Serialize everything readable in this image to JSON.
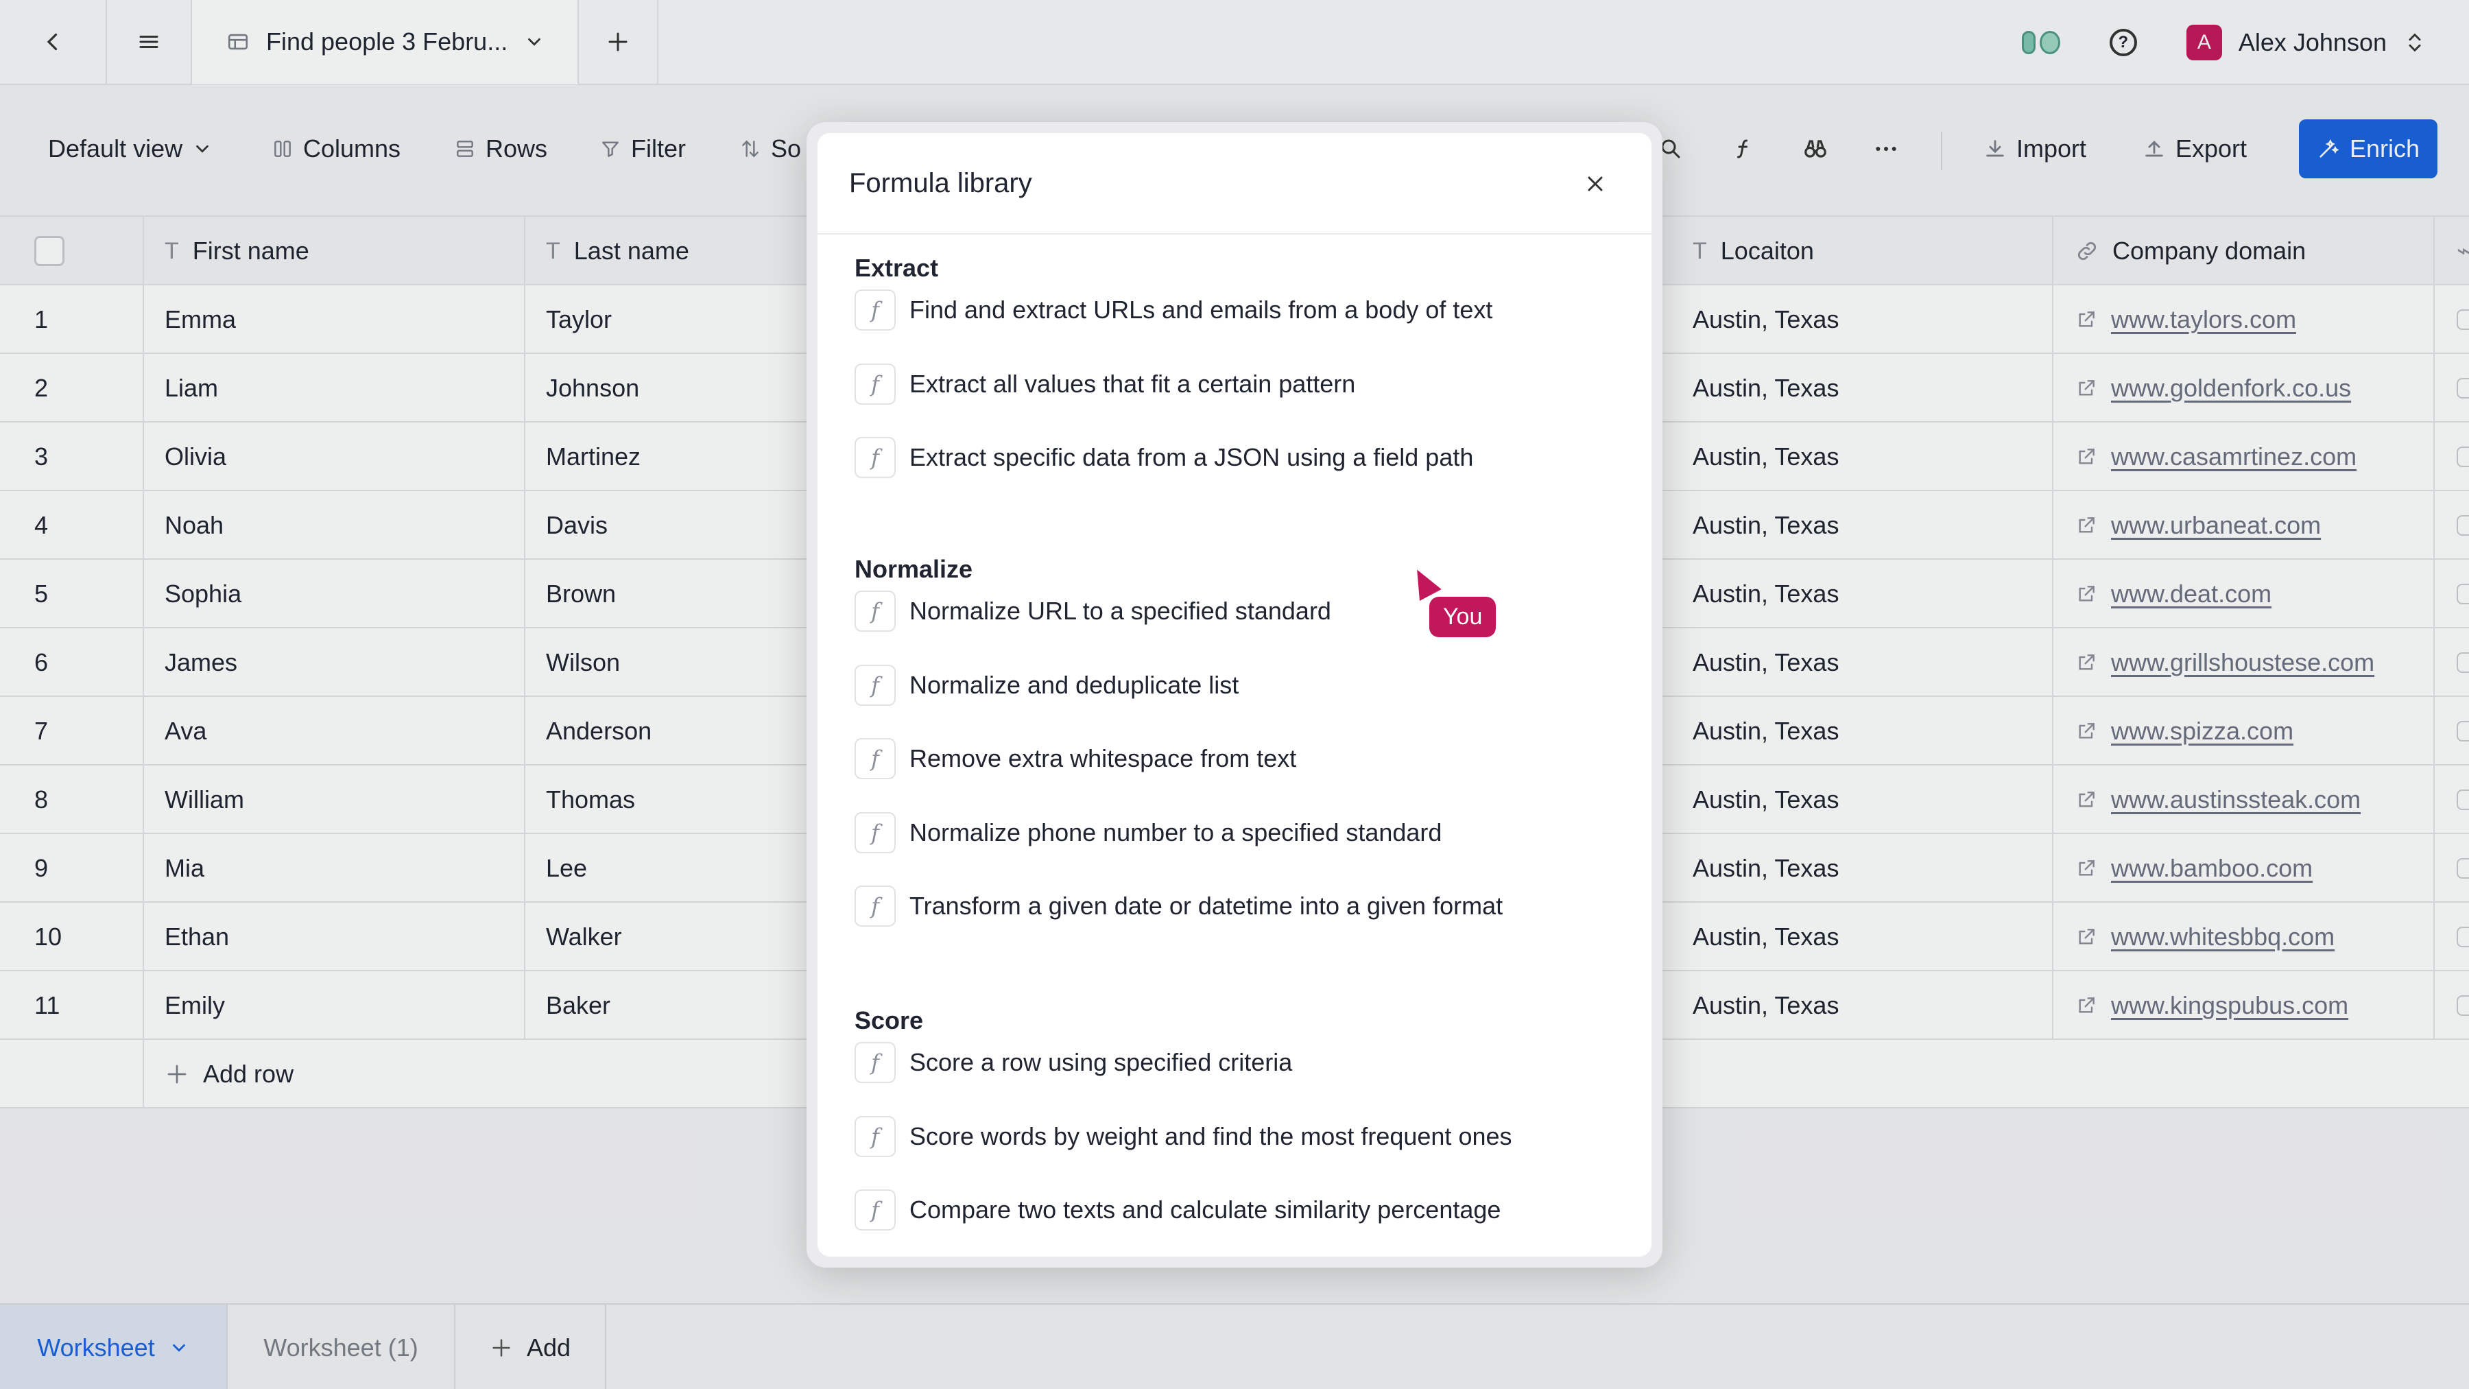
{
  "topbar": {
    "tab_title": "Find people 3 Febru...",
    "user_name": "Alex Johnson",
    "user_initial": "A"
  },
  "toolbar": {
    "view_label": "Default view",
    "columns_label": "Columns",
    "rows_label": "Rows",
    "filter_label": "Filter",
    "sort_label": "So",
    "import_label": "Import",
    "export_label": "Export",
    "enrich_label": "Enrich"
  },
  "table": {
    "headers": {
      "first_name": "First name",
      "last_name": "Last name",
      "location": "Locaiton",
      "company_domain": "Company domain"
    },
    "rows": [
      {
        "num": "1",
        "first": "Emma",
        "last": "Taylor",
        "location": "Austin, Texas",
        "domain": "www.taylors.com"
      },
      {
        "num": "2",
        "first": "Liam",
        "last": "Johnson",
        "location": "Austin, Texas",
        "domain": "www.goldenfork.co.us"
      },
      {
        "num": "3",
        "first": "Olivia",
        "last": "Martinez",
        "location": "Austin, Texas",
        "domain": "www.casamrtinez.com"
      },
      {
        "num": "4",
        "first": "Noah",
        "last": "Davis",
        "location": "Austin, Texas",
        "domain": "www.urbaneat.com"
      },
      {
        "num": "5",
        "first": "Sophia",
        "last": "Brown",
        "location": "Austin, Texas",
        "domain": "www.deat.com"
      },
      {
        "num": "6",
        "first": "James",
        "last": "Wilson",
        "location": "Austin, Texas",
        "domain": "www.grillshoustese.com"
      },
      {
        "num": "7",
        "first": "Ava",
        "last": "Anderson",
        "location": "Austin, Texas",
        "domain": "www.spizza.com"
      },
      {
        "num": "8",
        "first": "William",
        "last": "Thomas",
        "location": "Austin, Texas",
        "domain": "www.austinssteak.com"
      },
      {
        "num": "9",
        "first": "Mia",
        "last": "Lee",
        "location": "Austin, Texas",
        "domain": "www.bamboo.com"
      },
      {
        "num": "10",
        "first": "Ethan",
        "last": "Walker",
        "location": "Austin, Texas",
        "domain": "www.whitesbbq.com"
      },
      {
        "num": "11",
        "first": "Emily",
        "last": "Baker",
        "location": "Austin, Texas",
        "domain": "www.kingspubus.com"
      }
    ],
    "add_row_label": "Add row"
  },
  "modal": {
    "title": "Formula library",
    "sections": [
      {
        "title": "Extract",
        "items": [
          "Find and extract URLs and emails from a body of text",
          "Extract all values that fit a certain pattern",
          "Extract specific data from a JSON using a field path"
        ]
      },
      {
        "title": "Normalize",
        "items": [
          "Normalize URL to a specified standard",
          "Normalize and deduplicate list",
          "Remove extra whitespace from text",
          "Normalize phone number to a specified standard",
          "Transform a given date or datetime into a given format"
        ]
      },
      {
        "title": "Score",
        "items": [
          "Score a row using specified criteria",
          "Score words by weight and find the most frequent ones",
          "Compare two texts and calculate similarity percentage"
        ]
      }
    ]
  },
  "cursor_label": "You",
  "sheets": {
    "active": "Worksheet",
    "other": "Worksheet (1)",
    "add_label": "Add"
  },
  "colors": {
    "accent": "#1a63e0",
    "cursor": "#c2185b"
  }
}
